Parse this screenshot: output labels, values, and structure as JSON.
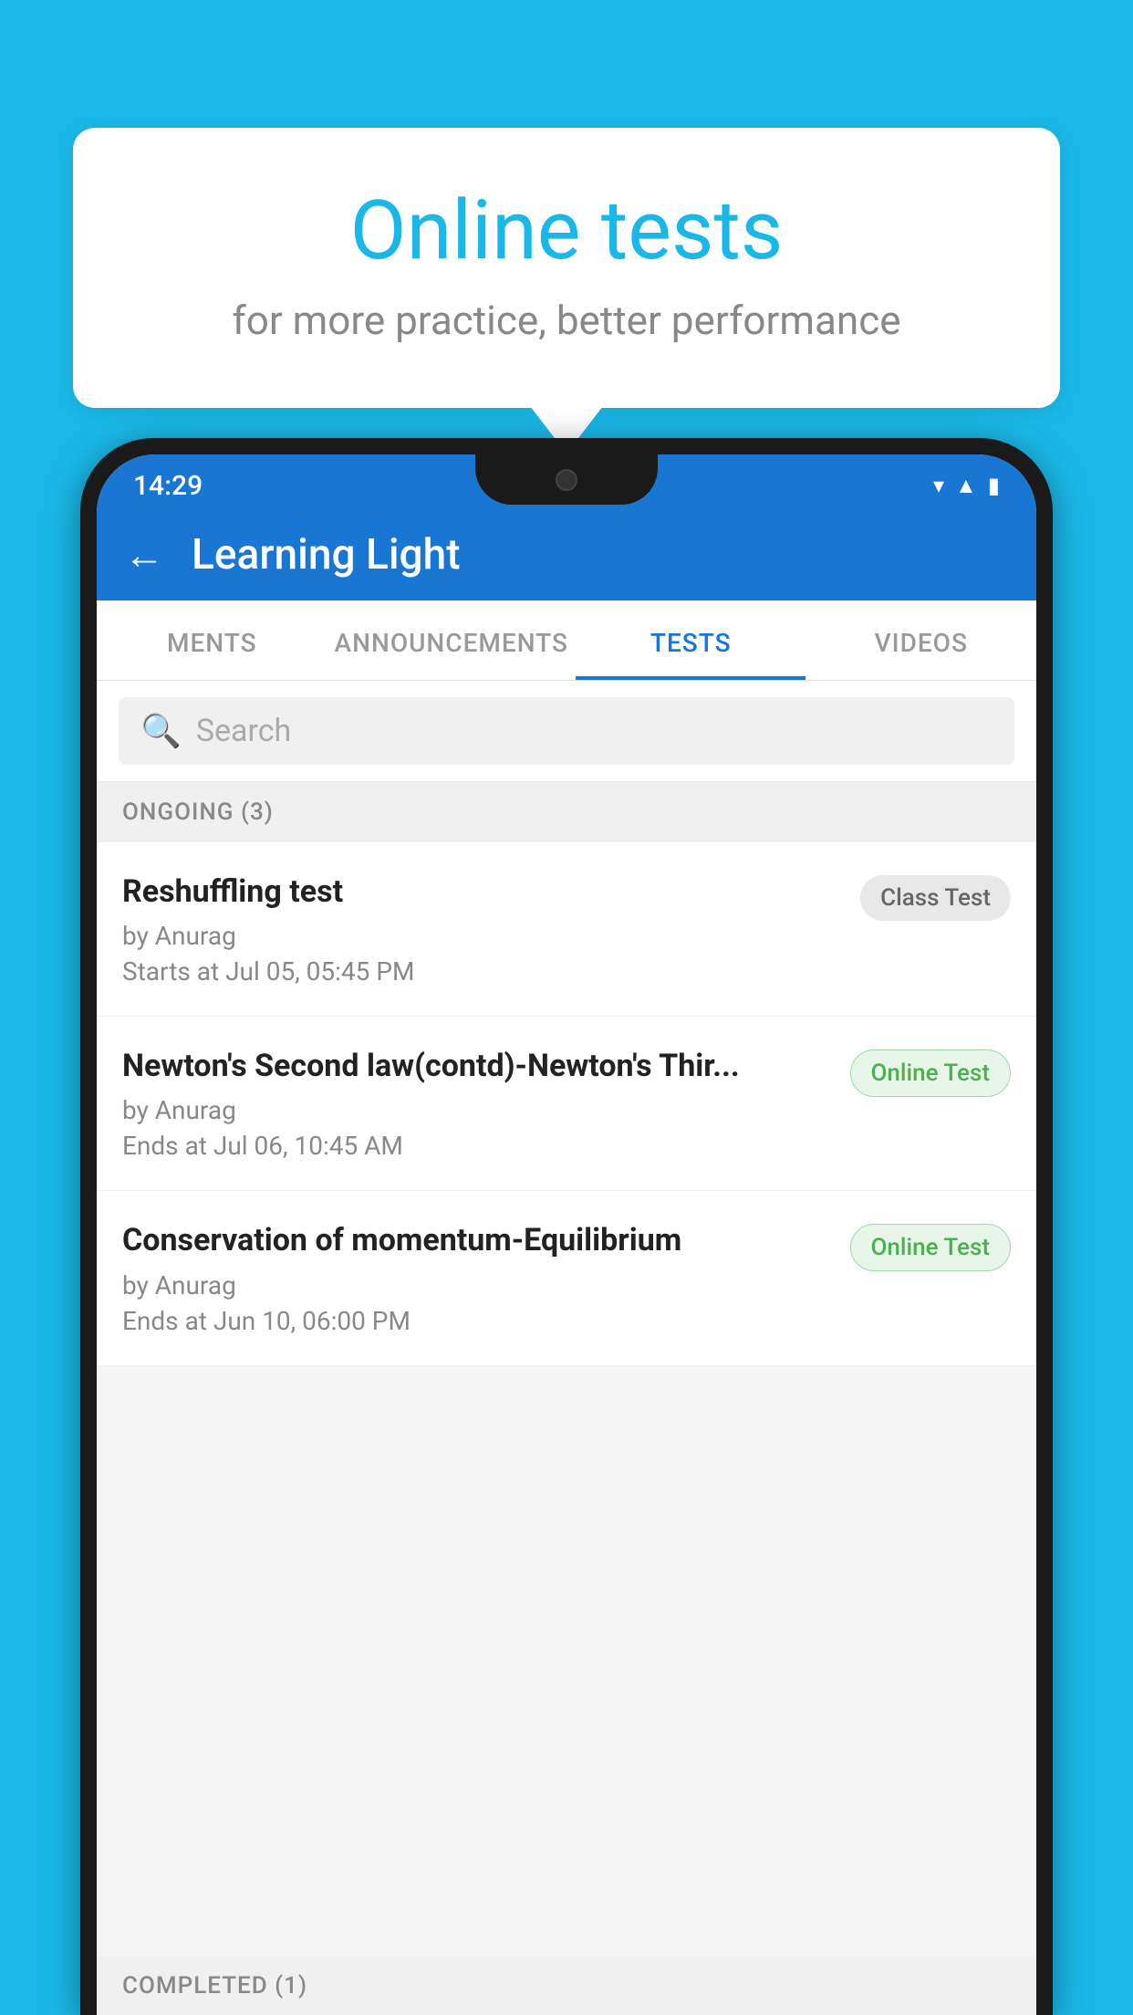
{
  "background": {
    "color": "#1ab8e8"
  },
  "speech_bubble": {
    "title": "Online tests",
    "subtitle": "for more practice, better performance"
  },
  "phone": {
    "status_bar": {
      "time": "14:29",
      "icons": [
        "wifi",
        "signal",
        "battery"
      ]
    },
    "app_bar": {
      "back_label": "←",
      "title": "Learning Light"
    },
    "tabs": [
      {
        "label": "MENTS",
        "active": false
      },
      {
        "label": "ANNOUNCEMENTS",
        "active": false
      },
      {
        "label": "TESTS",
        "active": true
      },
      {
        "label": "VIDEOS",
        "active": false
      }
    ],
    "search": {
      "placeholder": "Search"
    },
    "sections": [
      {
        "header": "ONGOING (3)",
        "items": [
          {
            "name": "Reshuffling test",
            "by": "by Anurag",
            "date": "Starts at  Jul 05, 05:45 PM",
            "badge": "Class Test",
            "badge_type": "class"
          },
          {
            "name": "Newton's Second law(contd)-Newton's Thir...",
            "by": "by Anurag",
            "date": "Ends at  Jul 06, 10:45 AM",
            "badge": "Online Test",
            "badge_type": "online"
          },
          {
            "name": "Conservation of momentum-Equilibrium",
            "by": "by Anurag",
            "date": "Ends at  Jun 10, 06:00 PM",
            "badge": "Online Test",
            "badge_type": "online"
          }
        ]
      }
    ],
    "completed_section": {
      "header": "COMPLETED (1)"
    }
  }
}
